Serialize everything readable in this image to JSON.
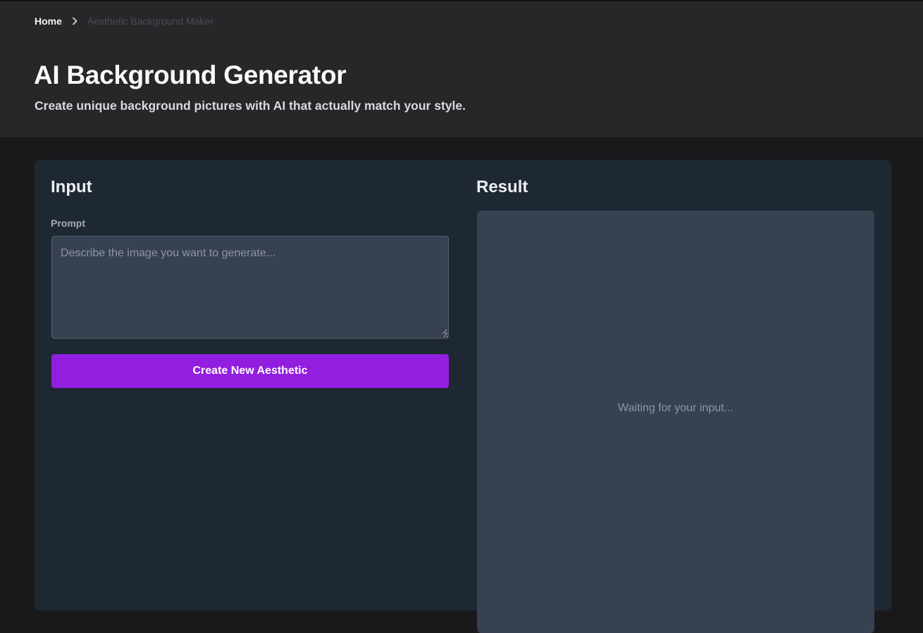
{
  "breadcrumb": {
    "home": "Home",
    "current": "Aesthetic Background Maker"
  },
  "header": {
    "title": "AI Background Generator",
    "subtitle": "Create unique background pictures with AI that actually match your style."
  },
  "input_section": {
    "heading": "Input",
    "prompt_label": "Prompt",
    "prompt_value": "",
    "prompt_placeholder": "Describe the image you want to generate...",
    "button_label": "Create New Aesthetic"
  },
  "result_section": {
    "heading": "Result",
    "placeholder": "Waiting for your input..."
  },
  "icons": {
    "breadcrumb_separator": "chevron-right-icon",
    "textarea_resize": "resize-grip-icon"
  },
  "colors": {
    "page_background": "#19191c",
    "header_background": "#27272a",
    "panel_background": "#1e2833",
    "field_background": "#374151",
    "accent": "#921ee0"
  }
}
